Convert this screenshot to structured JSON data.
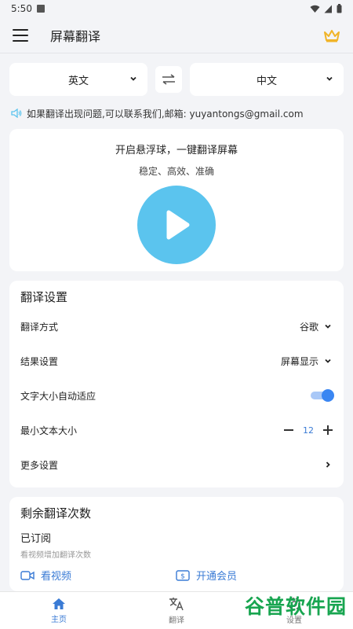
{
  "status": {
    "time": "5:50"
  },
  "appbar": {
    "title": "屏幕翻译"
  },
  "languages": {
    "source": "英文",
    "target": "中文"
  },
  "notice": {
    "text": "如果翻译出现问题,可以联系我们,邮箱:  yuyantongs@gmail.com"
  },
  "start": {
    "headline": "开启悬浮球，一键翻译屏幕",
    "subline": "稳定、高效、准确"
  },
  "settings": {
    "title": "翻译设置",
    "method_label": "翻译方式",
    "method_value": "谷歌",
    "result_label": "结果设置",
    "result_value": "屏幕显示",
    "autosize_label": "文字大小自动适应",
    "autosize_on": true,
    "min_size_label": "最小文本大小",
    "min_size_value": "12",
    "more_label": "更多设置"
  },
  "remaining": {
    "title": "剩余翻译次数",
    "status": "已订阅",
    "hint": "看视频增加翻译次数",
    "video_label": "看视频",
    "vip_label": "开通会员"
  },
  "nav": {
    "home": "主页",
    "translate": "翻译",
    "settings": "设置"
  },
  "watermark": "谷普软件园",
  "colors": {
    "accent": "#3a86f2",
    "play": "#5bc4ee",
    "crown": "#f0b429",
    "watermark": "#18a550"
  }
}
